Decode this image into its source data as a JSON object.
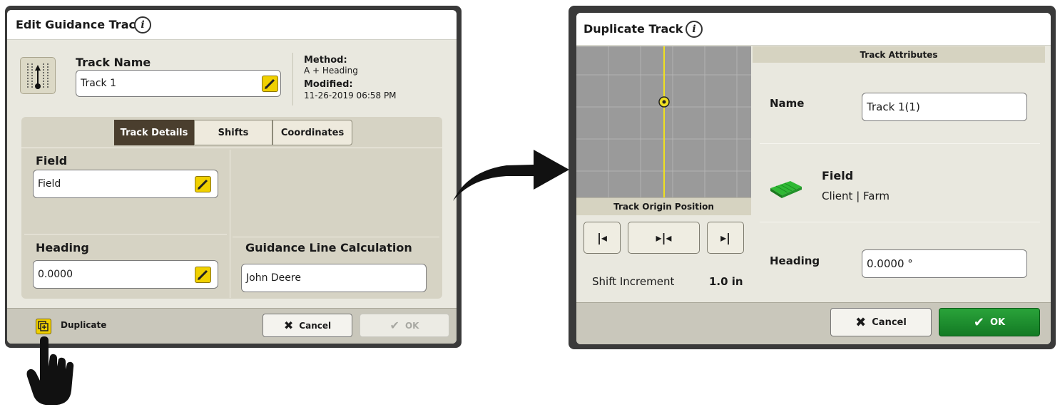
{
  "edit_dialog": {
    "title": "Edit Guidance Track",
    "track_name_label": "Track Name",
    "track_name_value": "Track 1",
    "method_label": "Method:",
    "method_value": "A + Heading",
    "modified_label": "Modified:",
    "modified_value": "11-26-2019 06:58 PM",
    "tabs": [
      {
        "label": "Track Details",
        "active": true
      },
      {
        "label": "Shifts",
        "active": false
      },
      {
        "label": "Coordinates",
        "active": false
      }
    ],
    "field_label": "Field",
    "field_value": "Field",
    "heading_label": "Heading",
    "heading_value": "0.0000",
    "glc_label": "Guidance Line Calculation",
    "glc_value": "John Deere",
    "duplicate_label": "Duplicate",
    "cancel_label": "Cancel",
    "ok_label": "OK",
    "ok_enabled": false
  },
  "duplicate_dialog": {
    "title": "Duplicate Track",
    "track_origin_label": "Track Origin Position",
    "nav_buttons": [
      "|◂",
      "▸|◂",
      "▸|"
    ],
    "shift_increment_label": "Shift Increment",
    "shift_increment_value": "1.0 in",
    "attributes_header": "Track Attributes",
    "name_label": "Name",
    "name_value": "Track 1(1)",
    "field_title": "Field",
    "field_subtitle": "Client | Farm",
    "heading_label": "Heading",
    "heading_value": "0.0000 °",
    "cancel_label": "Cancel",
    "ok_label": "OK"
  },
  "colors": {
    "accent_yellow": "#f0d000",
    "ok_green": "#1f9330",
    "tab_active": "#4a3e2e",
    "map_gray": "#9a9a9a",
    "guidance_line": "#f0e020"
  },
  "icons": [
    "info-icon",
    "track-ab-icon",
    "pencil-icon",
    "duplicate-icon",
    "close-x-icon",
    "checkmark-icon",
    "field-icon",
    "pointing-hand-icon",
    "arrow-icon"
  ]
}
